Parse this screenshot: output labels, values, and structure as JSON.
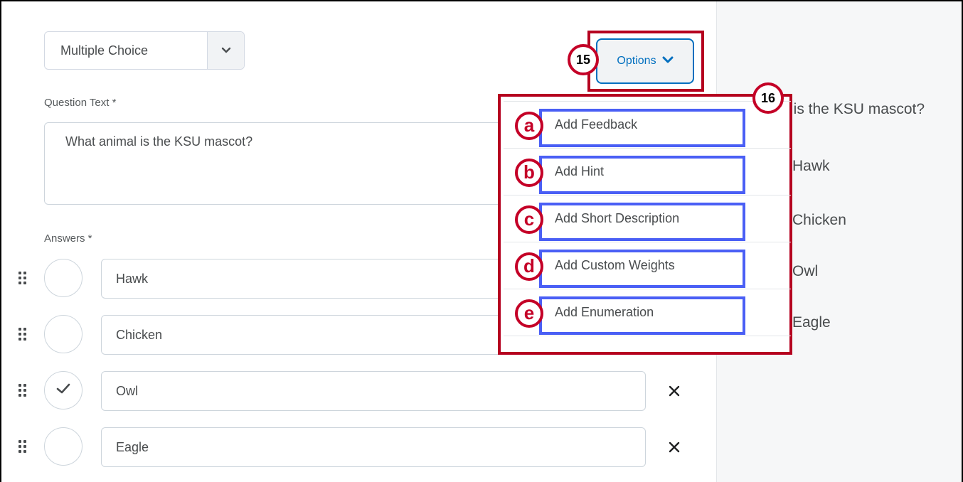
{
  "question_type": {
    "selected": "Multiple Choice"
  },
  "options_button": {
    "label": "Options",
    "callout": "15"
  },
  "question_text": {
    "label": "Question Text *",
    "value": "What animal is the KSU mascot?"
  },
  "answers": {
    "label": "Answers *",
    "items": [
      {
        "text": "Hawk",
        "correct": false
      },
      {
        "text": "Chicken",
        "correct": false
      },
      {
        "text": "Owl",
        "correct": true
      },
      {
        "text": "Eagle",
        "correct": false
      }
    ]
  },
  "options_menu": {
    "callout": "16",
    "items": [
      {
        "badge": "a",
        "label": "Add Feedback"
      },
      {
        "badge": "b",
        "label": "Add Hint"
      },
      {
        "badge": "c",
        "label": "Add Short Description"
      },
      {
        "badge": "d",
        "label": "Add Custom Weights"
      },
      {
        "badge": "e",
        "label": "Add Enumeration"
      }
    ]
  },
  "preview": {
    "question_fragment": "t is the KSU mascot?",
    "answers": [
      "Hawk",
      "Chicken",
      "Owl",
      "Eagle"
    ]
  },
  "colors": {
    "accent": "#006fbf",
    "callout_red": "#c40027",
    "highlight_blue": "#4a5ff5"
  }
}
